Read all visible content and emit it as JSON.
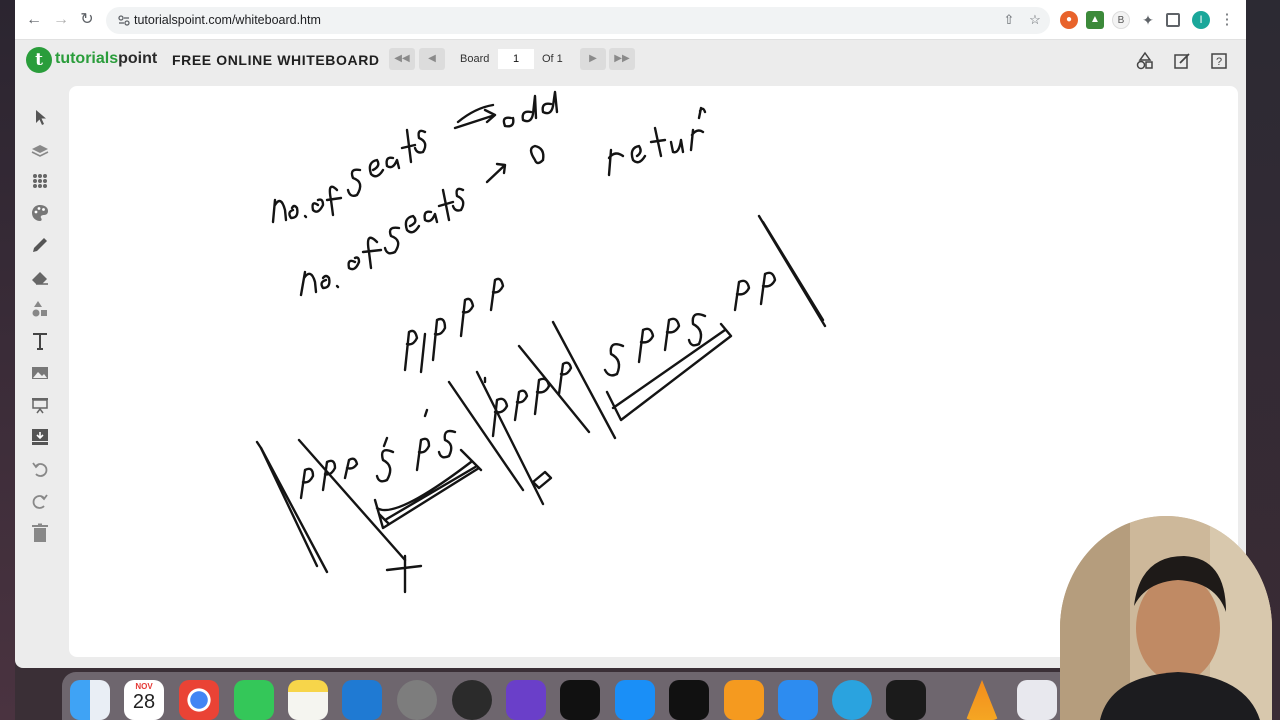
{
  "browser": {
    "url": "tutorialspoint.com/whiteboard.htm",
    "profile_initial": "I",
    "ext_badge": "B"
  },
  "app": {
    "logo_part1": "tutorials",
    "logo_part2": "point",
    "logo_letter": "t",
    "title": "FREE ONLINE WHITEBOARD",
    "board_label": "Board",
    "board_value": "1",
    "of_label": "Of 1"
  },
  "toolbar": {
    "tools": [
      "select",
      "layers",
      "grid",
      "palette",
      "pencil",
      "eraser",
      "shapes",
      "text",
      "image",
      "present",
      "download",
      "undo",
      "redo",
      "delete"
    ]
  },
  "canvas": {
    "handwriting": [
      "no. of seats → odd",
      "no. of seats → 0   return",
      "PPPP",
      "PPP S PS",
      "P P P P",
      "S P P S P P"
    ]
  },
  "dock": {
    "calendar_month": "NOV",
    "calendar_day": "28",
    "apps": [
      "finder",
      "calendar",
      "chrome",
      "facetime",
      "notes",
      "vscode",
      "system-settings",
      "obs",
      "imovie",
      "apple-tv",
      "app-store",
      "xp-pen",
      "pages",
      "sketch",
      "telegram",
      "terminal",
      "vlc",
      "mkv-to-mp4"
    ]
  },
  "colors": {
    "brand_green": "#2a9d3b",
    "canvas_bg": "#ffffff",
    "app_bg": "#ececec"
  }
}
